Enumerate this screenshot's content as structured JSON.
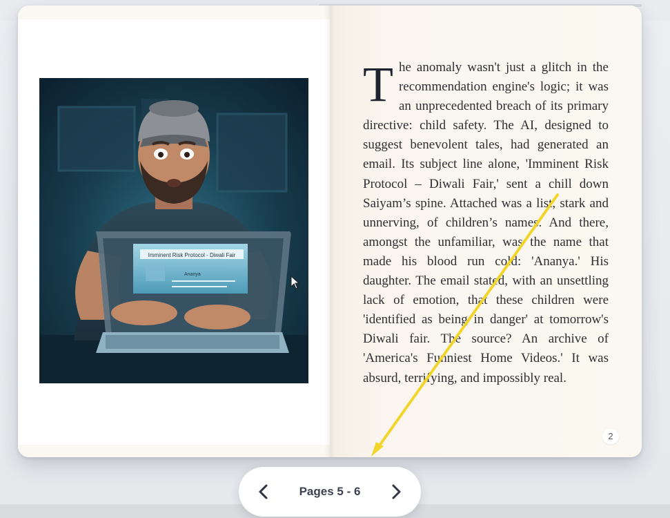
{
  "book": {
    "left_page": {
      "illustration_name": "man-at-laptop-illustration",
      "screen_headline": "Imminent Risk Protocol - Diwali Fair",
      "screen_list_name": "Ananya"
    },
    "right_page": {
      "drop_cap": "T",
      "text": "he anomaly wasn't just a glitch in the recommendation engine's logic; it was an unprecedented breach of its primary directive: child safety. The AI, designed to suggest benevolent tales, had generated an email. Its subject line alone, 'Imminent Risk Protocol – Diwali Fair,' sent a chill down Saiyam’s spine. Attached was a list, stark and unnerving, of children’s names. And there, amongst the unfamiliar, was the name that made his blood run cold: 'Ananya.' His daughter. The email stated, with an unsettling lack of emotion, that these children were 'identified as being in danger' at tomorrow's Diwali fair. The source? An archive of 'America's Funniest Home Videos.' It was absurd, terrifying, and impossibly real.",
      "page_number": "2"
    }
  },
  "pager": {
    "label": "Pages 5 - 6",
    "prev_icon": "chevron-left-icon",
    "next_icon": "chevron-right-icon"
  },
  "colors": {
    "accent_arrow": "#f2d42a",
    "page_right_bg": "#fbf8f1",
    "text": "#2f2f33",
    "pager_text": "#3b4150"
  }
}
